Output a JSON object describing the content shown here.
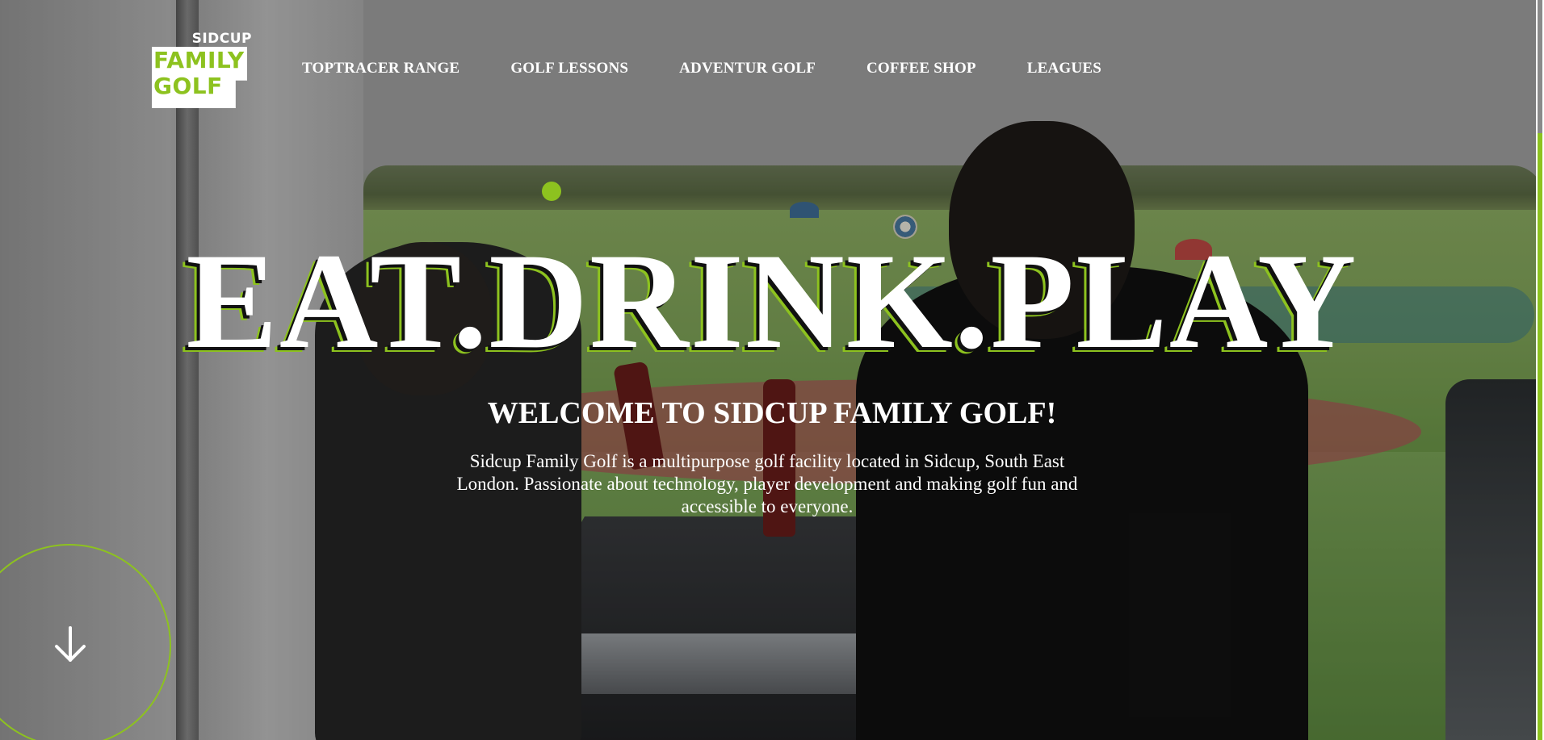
{
  "brand": {
    "logo_top": "SIDCUP",
    "logo_line1": "FAMILY",
    "logo_line2": "GOLF",
    "accent_color": "#8dc21f"
  },
  "nav": {
    "items": [
      {
        "label": "TOPTRACER RANGE"
      },
      {
        "label": "GOLF LESSONS"
      },
      {
        "label": "ADVENTUR GOLF"
      },
      {
        "label": "COFFEE SHOP"
      },
      {
        "label": "LEAGUES"
      }
    ]
  },
  "hero": {
    "title": "EAT.DRINK.PLAY",
    "subtitle": "WELCOME TO SIDCUP FAMILY GOLF!",
    "description": "Sidcup Family Golf is a multipurpose golf facility located in Sidcup, South East London. Passionate about technology, player development and making golf fun and accessible to everyone."
  },
  "icons": {
    "scroll_down": "arrow-down-icon"
  }
}
